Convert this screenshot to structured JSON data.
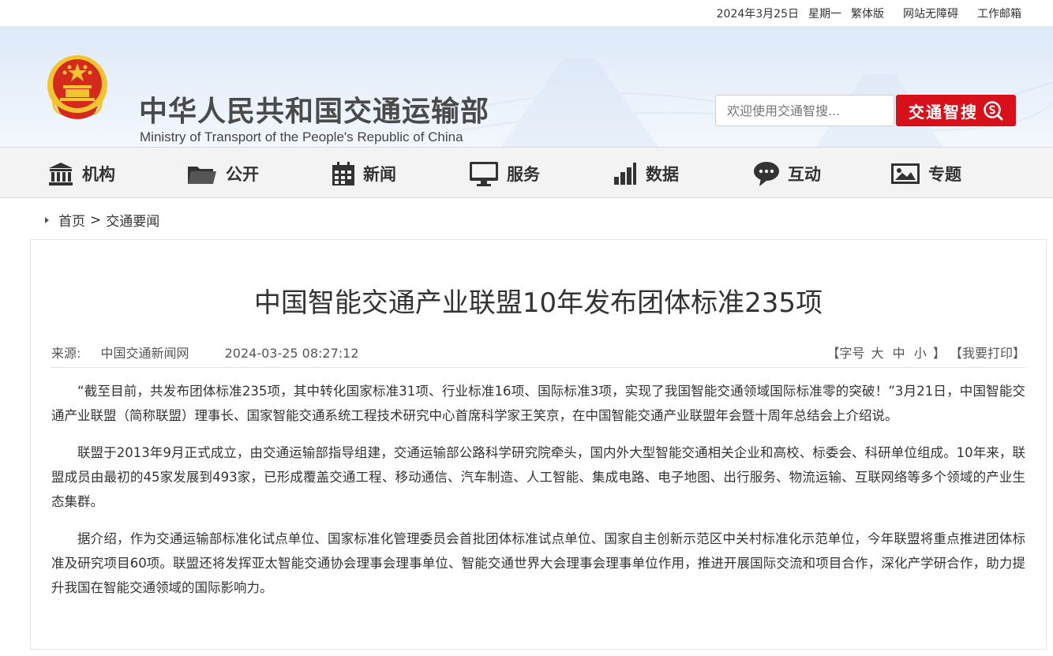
{
  "topbar": {
    "date": "2024年3月25日",
    "weekday": "星期一",
    "traditional": "繁体版",
    "accessibility": "网站无障碍",
    "mail": "工作邮箱"
  },
  "header": {
    "title_cn": "中华人民共和国交通运输部",
    "title_en": "Ministry of Transport of the People's Republic of China",
    "search_placeholder": "欢迎使用交通智搜...",
    "search_button": "交通智搜"
  },
  "nav": {
    "items": [
      {
        "label": "机构",
        "icon": "institution-icon"
      },
      {
        "label": "公开",
        "icon": "folder-icon"
      },
      {
        "label": "新闻",
        "icon": "calendar-icon"
      },
      {
        "label": "服务",
        "icon": "monitor-icon"
      },
      {
        "label": "数据",
        "icon": "bar-chart-icon"
      },
      {
        "label": "互动",
        "icon": "chat-icon"
      },
      {
        "label": "专题",
        "icon": "image-icon"
      }
    ]
  },
  "breadcrumb": {
    "home": "首页",
    "separator": ">",
    "current": "交通要闻"
  },
  "article": {
    "title": "中国智能交通产业联盟10年发布团体标准235项",
    "source_label": "来源:",
    "source": "中国交通新闻网",
    "datetime": "2024-03-25 08:27:12",
    "font_open": "【字号",
    "font_large": "大",
    "font_medium": "中",
    "font_small": "小",
    "font_close": "】",
    "print": "【我要打印】",
    "paragraphs": [
      "“截至目前，共发布团体标准235项，其中转化国家标准31项、行业标准16项、国际标准3项，实现了我国智能交通领域国际标准零的突破！”3月21日，中国智能交通产业联盟（简称联盟）理事长、国家智能交通系统工程技术研究中心首席科学家王笑京，在中国智能交通产业联盟年会暨十周年总结会上介绍说。",
      "联盟于2013年9月正式成立，由交通运输部指导组建，交通运输部公路科学研究院牵头，国内外大型智能交通相关企业和高校、标委会、科研单位组成。10年来，联盟成员由最初的45家发展到493家，已形成覆盖交通工程、移动通信、汽车制造、人工智能、集成电路、电子地图、出行服务、物流运输、互联网络等多个领域的产业生态集群。",
      "据介绍，作为交通运输部标准化试点单位、国家标准化管理委员会首批团体标准试点单位、国家自主创新示范区中关村标准化示范单位，今年联盟将重点推进团体标准及研究项目60项。联盟还将发挥亚太智能交通协会理事会理事单位、智能交通世界大会理事会理事单位作用，推进开展国际交流和项目合作，深化产学研合作，助力提升我国在智能交通领域的国际影响力。"
    ]
  },
  "colors": {
    "accent_red": "#d7101a",
    "header_bg": "#dde9f8",
    "nav_bg": "#f3f3f3",
    "emblem_red": "#d42a1e",
    "emblem_gold": "#f4c430"
  }
}
